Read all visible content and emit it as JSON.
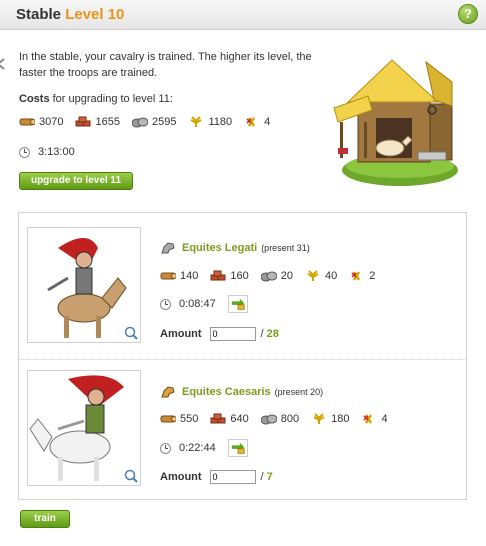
{
  "header": {
    "title": "Stable",
    "level": "Level 10",
    "help_label": "?"
  },
  "building": {
    "description": "In the stable, your cavalry is trained. The higher its level, the faster the troops are trained.",
    "costs_bold": "Costs",
    "costs_rest": " for upgrading to level 11:",
    "costs": {
      "wood": "3070",
      "clay": "1655",
      "iron": "2595",
      "crop": "1180",
      "upkeep": "4"
    },
    "time": "3:13:00",
    "upgrade_button": "upgrade to level 11"
  },
  "units": [
    {
      "name": "Equites Legati",
      "present": "(present 31)",
      "costs": {
        "wood": "140",
        "clay": "160",
        "iron": "20",
        "crop": "40",
        "upkeep": "2"
      },
      "time": "0:08:47",
      "amount_label": "Amount",
      "amount_value": "0",
      "max_prefix": "/",
      "max": "28"
    },
    {
      "name": "Equites Caesaris",
      "present": "(present 20)",
      "costs": {
        "wood": "550",
        "clay": "640",
        "iron": "800",
        "crop": "180",
        "upkeep": "4"
      },
      "time": "0:22:44",
      "amount_label": "Amount",
      "amount_value": "0",
      "max_prefix": "/",
      "max": "7"
    }
  ],
  "train_button": "train",
  "icons": {
    "wood": "wood-icon",
    "clay": "clay-icon",
    "iron": "iron-icon",
    "crop": "crop-icon",
    "upkeep": "upkeep-icon",
    "time": "clock-icon",
    "exchange": "npc-trade-icon",
    "zoom": "zoom-icon",
    "help": "help-icon"
  },
  "colors": {
    "level": "#e8941a",
    "unit_name": "#7a9e1f",
    "button": "#6fa81f"
  }
}
